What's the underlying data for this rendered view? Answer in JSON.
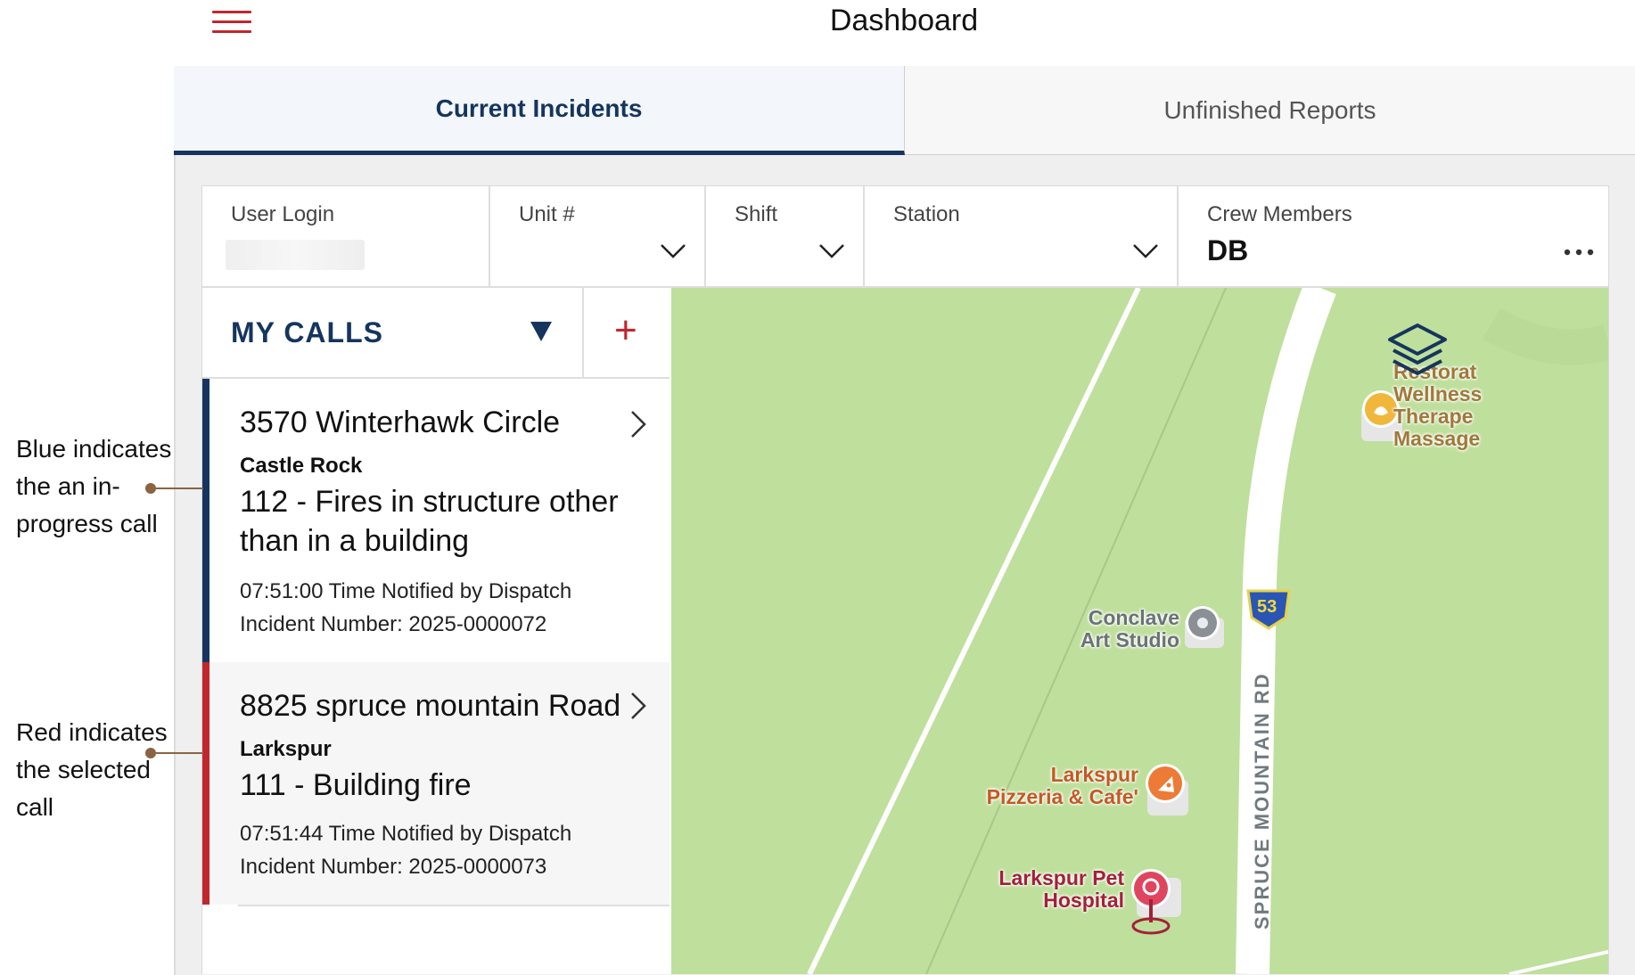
{
  "header": {
    "title": "Dashboard",
    "menu_icon": "hamburger-menu-icon"
  },
  "tabs": [
    {
      "label": "Current Incidents",
      "active": true
    },
    {
      "label": "Unfinished Reports",
      "active": false
    }
  ],
  "filters": {
    "user_login": {
      "label": "User Login",
      "value": ""
    },
    "unit": {
      "label": "Unit #"
    },
    "shift": {
      "label": "Shift"
    },
    "station": {
      "label": "Station"
    },
    "crew": {
      "label": "Crew Members",
      "value": "DB",
      "more_icon": "more-horizontal-icon"
    }
  },
  "calls_panel": {
    "title": "MY CALLS",
    "add_label": "+",
    "calls": [
      {
        "address": "3570 Winterhawk Circle",
        "city": "Castle Rock",
        "nature": "112 - Fires in structure other than in a building",
        "time_notified": "07:51:00 Time Notified by Dispatch",
        "incident_number": "Incident Number: 2025-0000072",
        "status_color": "#15355f"
      },
      {
        "address": "8825 spruce mountain Road",
        "city": "Larkspur",
        "nature": "111 - Building fire",
        "time_notified": "07:51:44 Time Notified by Dispatch",
        "incident_number": "Incident Number: 2025-0000073",
        "status_color": "#c0272d"
      }
    ]
  },
  "map": {
    "road_label": "SPRUCE MOUNTAIN RD",
    "route_shield": "53",
    "pois": [
      {
        "name": "Conclave\nArt Studio",
        "line1": "Conclave",
        "line2": "Art Studio",
        "icon": "studio-pin-icon",
        "color": "#6b7278"
      },
      {
        "line1": "Larkspur",
        "line2": "Pizzeria & Cafe'",
        "icon": "pizza-icon",
        "color": "#c45a22"
      },
      {
        "line1": "Larkspur Pet",
        "line2": "Hospital",
        "icon": "pet-hospital-icon",
        "color": "#a3203a"
      },
      {
        "line1": "Restorat",
        "line2": "Wellness",
        "line3": "Therape",
        "line4": "Massage",
        "icon": "lotus-icon",
        "color": "#a0793a"
      }
    ],
    "layers_icon": "layers-icon"
  },
  "annotations": {
    "blue": {
      "line1": "Blue indicates",
      "line2": "the an in-",
      "line3": "progress call"
    },
    "red": {
      "line1": "Red indicates",
      "line2": "the selected",
      "line3": "call"
    }
  },
  "colors": {
    "brand_navy": "#15355f",
    "brand_red": "#c0272d",
    "map_green": "#bfdf9c"
  }
}
